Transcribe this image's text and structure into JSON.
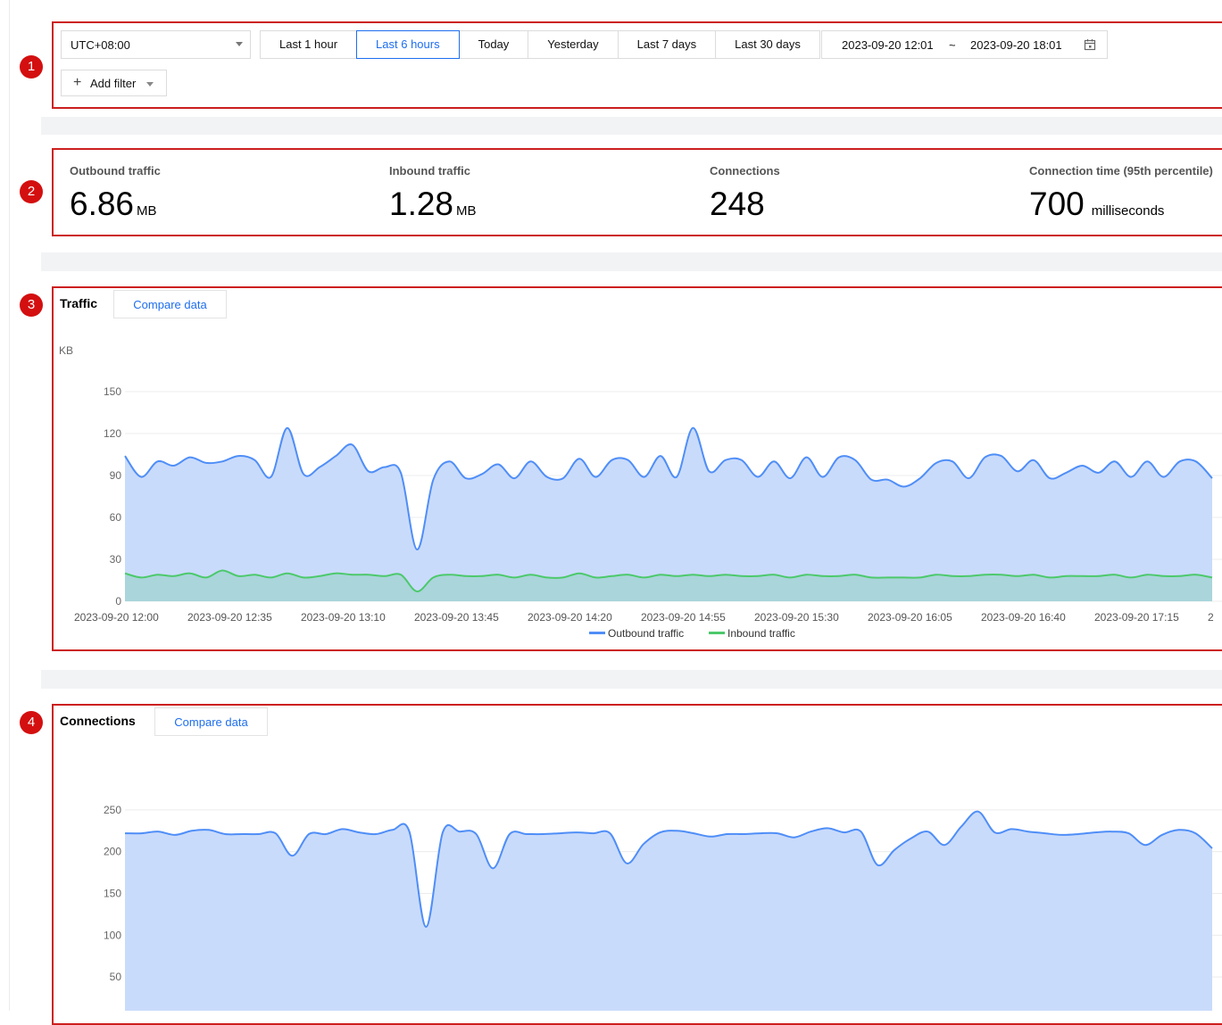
{
  "annotations": [
    "1",
    "2",
    "3",
    "4"
  ],
  "filters": {
    "timezone": "UTC+08:00",
    "ranges": [
      "Last 1 hour",
      "Last 6 hours",
      "Today",
      "Yesterday",
      "Last 7 days",
      "Last 30 days"
    ],
    "active_range": "Last 6 hours",
    "date_start": "2023-09-20 12:01",
    "date_separator": "~",
    "date_end": "2023-09-20 18:01",
    "add_filter_label": "Add filter"
  },
  "metrics": {
    "outbound": {
      "label": "Outbound traffic",
      "value": "6.86",
      "unit": "MB"
    },
    "inbound": {
      "label": "Inbound traffic",
      "value": "1.28",
      "unit": "MB"
    },
    "connections": {
      "label": "Connections",
      "value": "248",
      "unit": ""
    },
    "conn_time": {
      "label": "Connection time (95th percentile)",
      "value": "700",
      "unit": "milliseconds"
    }
  },
  "traffic_panel": {
    "title": "Traffic",
    "compare_label": "Compare data"
  },
  "connections_panel": {
    "title": "Connections",
    "compare_label": "Compare data"
  },
  "colors": {
    "accent": "#1e6ef0",
    "outbound_line": "#4f8ef7",
    "outbound_fill": "#c9dbfb",
    "inbound_line": "#4cc96b",
    "inbound_fill": "#a9d5db",
    "annotation": "#d40f0f"
  },
  "chart_data": [
    {
      "type": "area",
      "title": "Traffic",
      "ylabel": "KB",
      "ylim": [
        0,
        150
      ],
      "yticks": [
        0,
        30,
        60,
        90,
        120,
        150
      ],
      "x_labels": [
        "2023-09-20 12:00",
        "2023-09-20 12:35",
        "2023-09-20 13:10",
        "2023-09-20 13:45",
        "2023-09-20 14:20",
        "2023-09-20 14:55",
        "2023-09-20 15:30",
        "2023-09-20 16:05",
        "2023-09-20 16:40",
        "2023-09-20 17:15",
        "2"
      ],
      "series": [
        {
          "name": "Outbound traffic",
          "values": [
            104,
            89,
            100,
            97,
            103,
            99,
            100,
            104,
            101,
            89,
            124,
            91,
            96,
            104,
            112,
            93,
            96,
            92,
            37,
            87,
            100,
            88,
            91,
            98,
            88,
            100,
            89,
            88,
            102,
            89,
            101,
            101,
            89,
            104,
            89,
            124,
            93,
            101,
            101,
            89,
            100,
            88,
            103,
            89,
            103,
            101,
            87,
            87,
            82,
            88,
            99,
            100,
            88,
            103,
            104,
            93,
            101,
            88,
            92,
            97,
            92,
            100,
            89,
            100,
            89,
            100,
            100,
            88
          ]
        },
        {
          "name": "Inbound traffic",
          "values": [
            20,
            17,
            19,
            18,
            20,
            17,
            22,
            18,
            19,
            17,
            20,
            17,
            18,
            20,
            19,
            19,
            18,
            19,
            7,
            17,
            19,
            18,
            18,
            19,
            17,
            19,
            17,
            17,
            20,
            17,
            18,
            19,
            17,
            19,
            18,
            19,
            18,
            19,
            18,
            18,
            19,
            17,
            19,
            18,
            18,
            19,
            17,
            17,
            17,
            17,
            19,
            18,
            18,
            19,
            19,
            18,
            19,
            17,
            18,
            18,
            18,
            19,
            17,
            19,
            18,
            18,
            19,
            17
          ]
        }
      ],
      "legend": "bottom-center",
      "grid": true
    },
    {
      "type": "area",
      "title": "Connections",
      "ylim": [
        0,
        300
      ],
      "yticks": [
        50,
        100,
        150,
        200,
        250
      ],
      "series": [
        {
          "name": "Connections",
          "values": [
            222,
            222,
            224,
            220,
            225,
            226,
            221,
            221,
            221,
            222,
            195,
            221,
            221,
            227,
            223,
            221,
            226,
            224,
            110,
            223,
            224,
            221,
            180,
            221,
            221,
            221,
            222,
            223,
            222,
            222,
            186,
            209,
            223,
            225,
            222,
            218,
            221,
            221,
            222,
            222,
            217,
            224,
            228,
            223,
            224,
            184,
            202,
            216,
            224,
            208,
            230,
            248,
            223,
            227,
            224,
            222,
            220,
            221,
            223,
            224,
            222,
            208,
            220,
            226,
            222,
            204
          ]
        }
      ],
      "grid": true
    }
  ]
}
